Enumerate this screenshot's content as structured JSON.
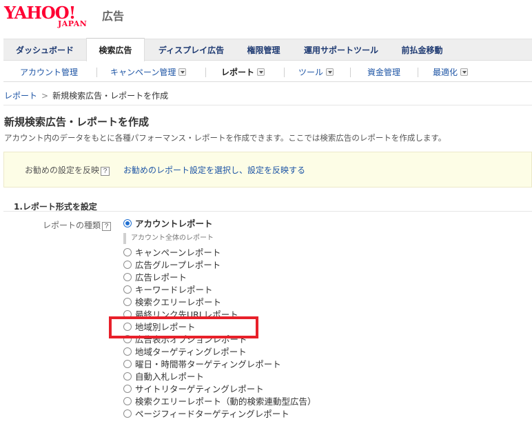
{
  "logo": {
    "brand": "YAHOO!",
    "region": "JAPAN",
    "product": "広告"
  },
  "tabs": [
    {
      "label": "ダッシュボード"
    },
    {
      "label": "検索広告",
      "active": true
    },
    {
      "label": "ディスプレイ広告"
    },
    {
      "label": "権限管理"
    },
    {
      "label": "運用サポートツール"
    },
    {
      "label": "前払金移動"
    }
  ],
  "subnav": [
    {
      "label": "アカウント管理",
      "dropdown": false
    },
    {
      "label": "キャンペーン管理",
      "dropdown": true
    },
    {
      "label": "レポート",
      "dropdown": true,
      "current": true
    },
    {
      "label": "ツール",
      "dropdown": true
    },
    {
      "label": "資金管理",
      "dropdown": false
    },
    {
      "label": "最適化",
      "dropdown": true
    }
  ],
  "breadcrumb": {
    "parent": "レポート",
    "separator": ">",
    "current": "新規検索広告・レポートを作成"
  },
  "page": {
    "title": "新規検索広告・レポートを作成",
    "description": "アカウント内のデータをもとに各種パフォーマンス・レポートを作成できます。ここでは検索広告のレポートを作成します。"
  },
  "recommend": {
    "label": "お勧めの設定を反映",
    "help": "?",
    "link": "お勧めのレポート設定を選択し、設定を反映する"
  },
  "section1": {
    "title": "1.レポート形式を設定"
  },
  "report_type": {
    "label": "レポートの種類",
    "help": "?",
    "selected_note": "アカウント全体のレポート",
    "options": [
      {
        "label": "アカウントレポート",
        "selected": true
      },
      {
        "label": "キャンペーンレポート"
      },
      {
        "label": "広告グループレポート"
      },
      {
        "label": "広告レポート"
      },
      {
        "label": "キーワードレポート"
      },
      {
        "label": "検索クエリーレポート"
      },
      {
        "label": "最終リンク先URLレポート"
      },
      {
        "label": "地域別レポート",
        "highlighted": true
      },
      {
        "label": "広告表示オプションレポート"
      },
      {
        "label": "地域ターゲティングレポート"
      },
      {
        "label": "曜日・時間帯ターゲティングレポート"
      },
      {
        "label": "自動入札レポート"
      },
      {
        "label": "サイトリターゲティングレポート"
      },
      {
        "label": "検索クエリーレポート（動的検索連動型広告）"
      },
      {
        "label": "ページフィードターゲティングレポート"
      }
    ]
  },
  "colors": {
    "brand_red": "#ff0033",
    "link_blue": "#1e55a5",
    "highlight_red": "#e8202a",
    "radio_blue": "#1f6fd1"
  }
}
